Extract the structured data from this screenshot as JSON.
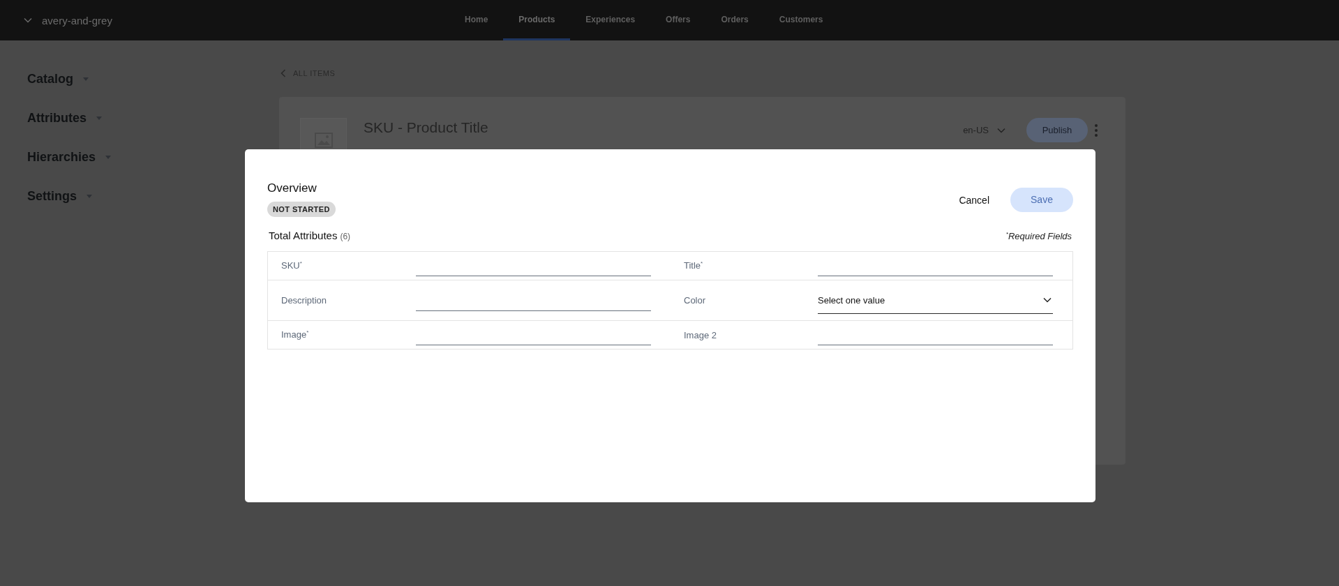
{
  "top_bar": {
    "store": "avery-and-grey",
    "nav": [
      {
        "label": "Home",
        "selected": false
      },
      {
        "label": "Products",
        "selected": true
      },
      {
        "label": "Experiences",
        "selected": false
      },
      {
        "label": "Offers",
        "selected": false
      },
      {
        "label": "Orders",
        "selected": false
      },
      {
        "label": "Customers",
        "selected": false
      }
    ]
  },
  "sidebar": {
    "items": [
      {
        "label": "Catalog"
      },
      {
        "label": "Attributes"
      },
      {
        "label": "Hierarchies"
      },
      {
        "label": "Settings"
      }
    ]
  },
  "back_link": "ALL ITEMS",
  "product": {
    "title": "SKU - Product Title",
    "locale": "en-US",
    "publish": {
      "label": "Publish",
      "disabled": true
    }
  },
  "modal": {
    "title": "Overview",
    "status": "NOT STARTED",
    "cancel": "Cancel",
    "save": {
      "label": "Save",
      "disabled": true
    },
    "attributes_label": "Total Attributes",
    "attributes_count": "(6)",
    "required_note": "$^{*}$Required Fields",
    "fields": [
      {
        "label": "SKU$^{*}$",
        "kind": "text"
      },
      {
        "label": "Title$^{*}$",
        "kind": "text"
      },
      {
        "label": "Description",
        "kind": "text"
      },
      {
        "label": "Color",
        "kind": "select",
        "placeholder": "Select one value"
      },
      {
        "label": "Image$^{*}$",
        "kind": "text"
      },
      {
        "label": "Image 2",
        "kind": "text"
      }
    ]
  }
}
